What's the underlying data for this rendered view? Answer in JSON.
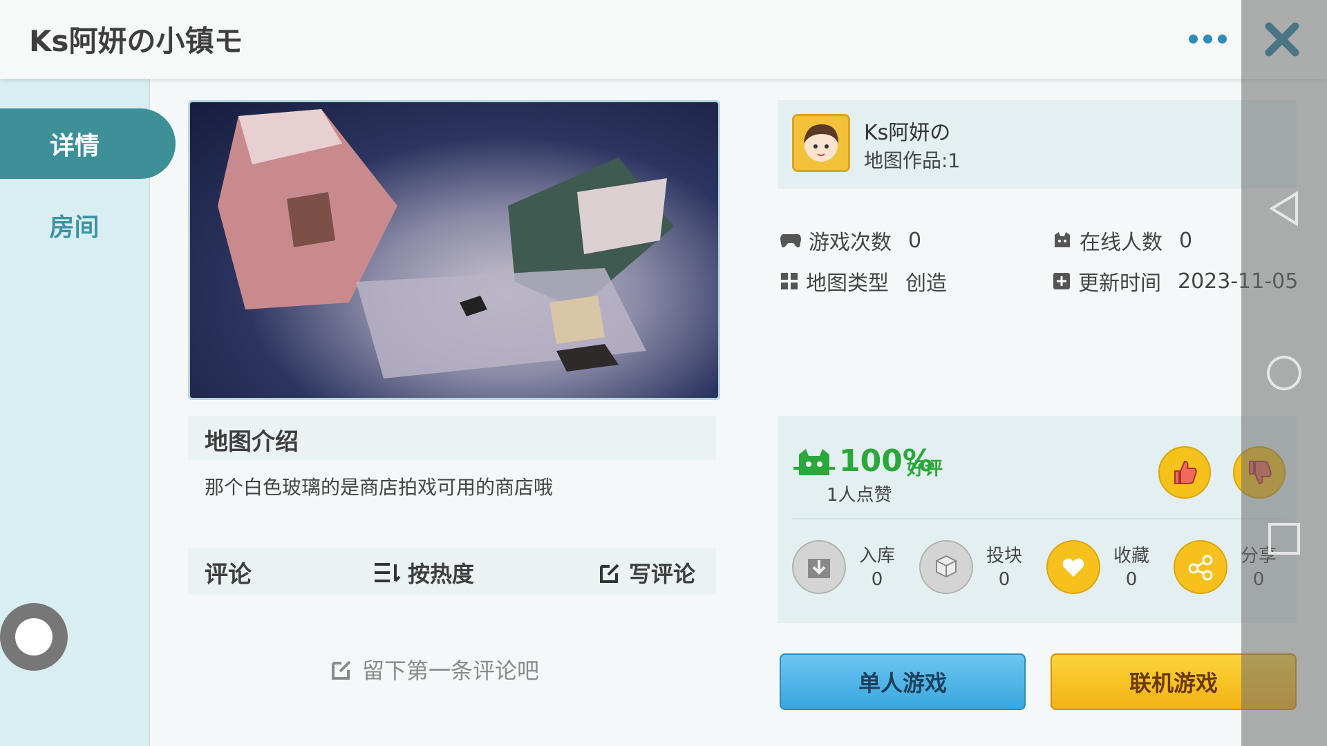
{
  "header": {
    "title": "Ks阿妍の小镇モ"
  },
  "sidebar": {
    "tabs": [
      {
        "label": "详情"
      },
      {
        "label": "房间"
      }
    ]
  },
  "intro": {
    "heading": "地图介绍",
    "text": "那个白色玻璃的是商店拍戏可用的商店哦"
  },
  "comments": {
    "heading": "评论",
    "sort_label": "按热度",
    "write_label": "写评论",
    "empty_text": "留下第一条评论吧"
  },
  "author": {
    "name": "Ks阿妍の",
    "works": "地图作品:1"
  },
  "stats": {
    "plays_label": "游戏次数",
    "plays_value": "0",
    "online_label": "在线人数",
    "online_value": "0",
    "type_label": "地图类型",
    "type_value": "创造",
    "updated_label": "更新时间",
    "updated_value": "2023-11-05"
  },
  "rating": {
    "percent": "100%",
    "percent_suffix": "好评",
    "likes": "1人点赞"
  },
  "actions": [
    {
      "label": "入库",
      "count": "0",
      "icon": "download-icon"
    },
    {
      "label": "投块",
      "count": "0",
      "icon": "block-icon"
    },
    {
      "label": "收藏",
      "count": "0",
      "icon": "heart-icon"
    },
    {
      "label": "分享",
      "count": "0",
      "icon": "share-icon"
    }
  ],
  "buttons": {
    "single": "单人游戏",
    "multi": "联机游戏"
  },
  "colors": {
    "accent_teal": "#3d8f98",
    "blue": "#39a7e0",
    "yellow": "#f7c11d",
    "green": "#2ba83c"
  }
}
